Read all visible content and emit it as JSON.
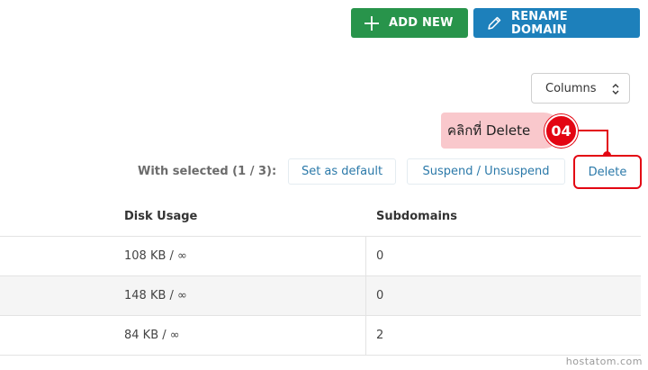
{
  "toolbar": {
    "add_new_label": "ADD NEW",
    "rename_domain_label": "RENAME DOMAIN"
  },
  "columns_select": {
    "value": "Columns"
  },
  "annotation": {
    "callout_text": "คลิกที่ Delete",
    "step_number": "04",
    "color": "#e30613"
  },
  "bulk_actions": {
    "label": "With selected (1 / 3):",
    "set_default": "Set as default",
    "suspend": "Suspend / Unsuspend",
    "delete": "Delete"
  },
  "table": {
    "headers": {
      "disk_usage": "Disk Usage",
      "subdomains": "Subdomains"
    },
    "rows": [
      {
        "disk_usage": "108 KB / ∞",
        "subdomains": "0"
      },
      {
        "disk_usage": "148 KB / ∞",
        "subdomains": "0"
      },
      {
        "disk_usage": "84 KB / ∞",
        "subdomains": "2"
      }
    ]
  },
  "watermark": "hostatom.com",
  "colors": {
    "add_new": "#28944b",
    "rename_domain": "#1d80bb",
    "link": "#2b79a9"
  }
}
